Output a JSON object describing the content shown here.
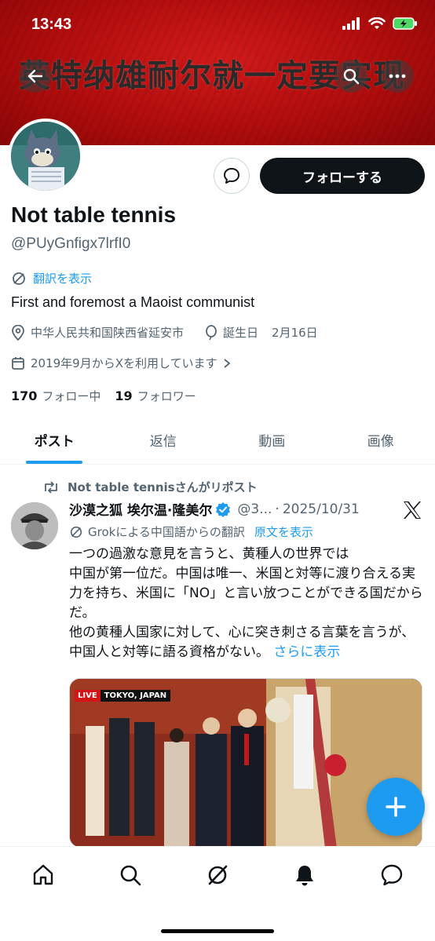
{
  "status_bar": {
    "time": "13:43"
  },
  "banner": {
    "text": "英特纳雄耐尔就一定要实现"
  },
  "profile": {
    "display_name": "Not table tennis",
    "handle": "@PUyGnfigx7lrfI0",
    "translate_label": "翻訳を表示",
    "bio": "First and foremost a Maoist communist",
    "location": "中华人民共和国陕西省延安市",
    "birthday_label": "誕生日",
    "birthday": "2月16日",
    "joined": "2019年9月からXを利用しています",
    "following_count": "170",
    "following_label": "フォロー中",
    "followers_count": "19",
    "followers_label": "フォロワー",
    "follow_button": "フォローする"
  },
  "tabs": [
    {
      "label": "ポスト",
      "active": true
    },
    {
      "label": "返信",
      "active": false
    },
    {
      "label": "動画",
      "active": false
    },
    {
      "label": "画像",
      "active": false
    }
  ],
  "post": {
    "repost_label": "Not table tennisさんがリポスト",
    "author": "沙漠之狐 埃尔温·隆美尔",
    "handle_trunc": "@3...",
    "separator": "·",
    "date": "2025/10/31",
    "grok_label": "Grokによる中国語からの翻訳",
    "original_link": "原文を表示",
    "body_line1": "一つの過激な意見を言うと、黄種人の世界では\n中国が第一位だ。中国は唯一、米国と対等に渡り合える実力を持ち、米国に「NO」と言い放つことができる国だからだ。",
    "body_line2": "他の黄種人国家に対して、心に突き刺さる言葉を言うが、中国人と対等に語る資格がない。",
    "show_more": "さらに表示",
    "media_live": "LIVE",
    "media_location": "TOKYO, JAPAN"
  },
  "colors": {
    "accent": "#1d9bf0",
    "text": "#0f1419",
    "secondary": "#536471",
    "banner": "#b20d0d"
  },
  "icons": {
    "back": "arrow-left-icon",
    "search": "search-icon",
    "more": "more-icon",
    "message": "message-icon",
    "translate": "translate-icon",
    "location": "location-icon",
    "birthday": "balloon-icon",
    "calendar": "calendar-icon",
    "repost": "repost-icon",
    "verified": "verified-icon",
    "x": "x-logo-icon",
    "compose": "plus-icon",
    "nav": [
      "home-icon",
      "search-icon",
      "grok-icon",
      "notifications-icon",
      "messages-icon"
    ]
  }
}
